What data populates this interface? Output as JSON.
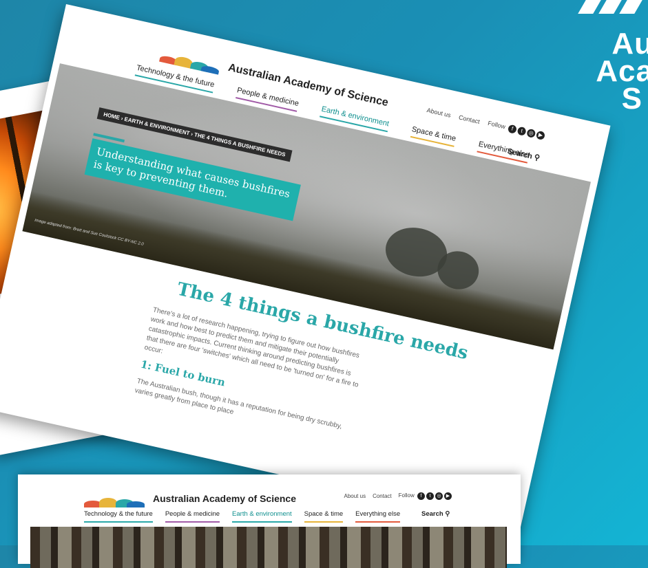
{
  "brand": {
    "corner_lines": [
      "Au",
      "Aca",
      "S"
    ]
  },
  "main_page": {
    "logo_text": "Australian Academy of Science",
    "utility": {
      "about": "About us",
      "contact": "Contact",
      "follow": "Follow"
    },
    "nav": {
      "tech": "Technology & the future",
      "people": "People & medicine",
      "earth": "Earth & environment",
      "space": "Space & time",
      "everything": "Everything else",
      "search": "Search"
    },
    "breadcrumb": "HOME › EARTH & ENVIRONMENT › THE 4 THINGS A BUSHFIRE NEEDS",
    "tagline": "Understanding what causes bushfires is key to preventing them.",
    "image_credit": "Image adapted from: Brett and Sue Coulstock CC BY-NC 2.0",
    "title": "The 4 things a bushfire needs",
    "intro": "There's a lot of research happening, trying to figure out how bushfires work and how best to predict them and mitigate their potentially catastrophic impacts. Current thinking around predicting bushfires is that there are four 'switches' which all need to be 'turned on' for a fire to occur:",
    "section_heading": "1: Fuel to burn",
    "section_body": "The Australian bush, though it has a reputation for being dry scrubby, varies greatly from place to place"
  },
  "bottom_page": {
    "logo_text": "Australian Academy of Science",
    "utility": {
      "about": "About us",
      "contact": "Contact",
      "follow": "Follow"
    },
    "nav": {
      "tech": "Technology & the future",
      "people": "People & medicine",
      "earth": "Earth & environment",
      "space": "Space & time",
      "everything": "Everything else",
      "search": "Search"
    }
  },
  "social_icons": [
    "facebook-icon",
    "twitter-icon",
    "instagram-icon",
    "youtube-icon"
  ],
  "colors": {
    "teal": "#2aa7a8",
    "purple": "#a15ba7",
    "yellow": "#e7b43a",
    "red": "#e35a3c",
    "bg": "#1a8fb5"
  }
}
